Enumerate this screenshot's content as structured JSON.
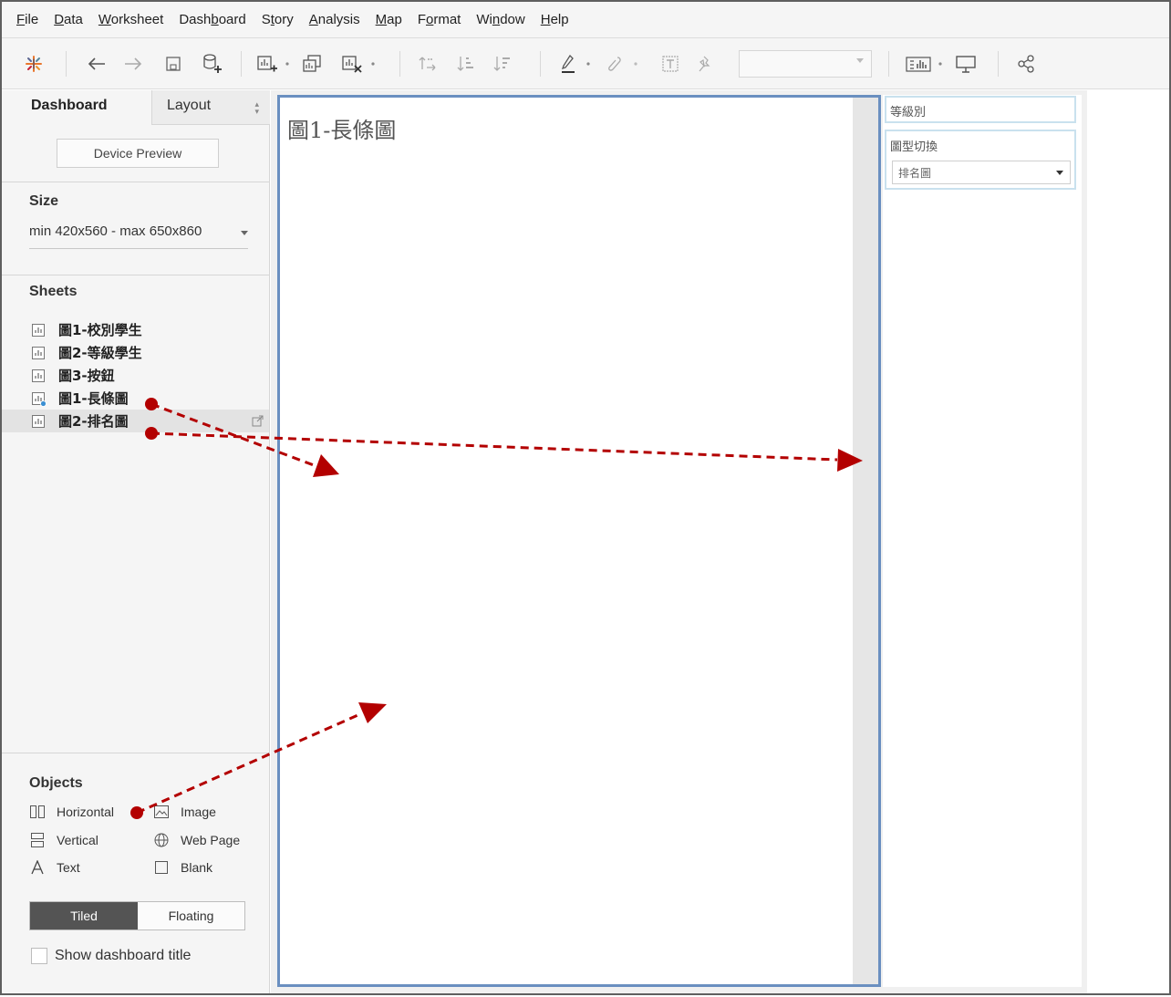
{
  "menu": [
    "File",
    "Data",
    "Worksheet",
    "Dashboard",
    "Story",
    "Analysis",
    "Map",
    "Format",
    "Window",
    "Help"
  ],
  "menu_mnemonics": [
    "F",
    "D",
    "W",
    "b",
    "t",
    "A",
    "M",
    "o",
    "n",
    "H"
  ],
  "icons": {
    "logo": "tableau-logo-icon",
    "back": "undo-arrow-icon",
    "forward": "redo-arrow-icon",
    "save": "save-icon",
    "new_datasource": "new-datasource-icon",
    "new_sheet": "new-worksheet-icon",
    "duplicate": "duplicate-sheet-icon",
    "clear": "clear-sheet-icon",
    "swap": "swap-rows-columns-icon",
    "sort_asc": "sort-ascending-icon",
    "sort_desc": "sort-descending-icon",
    "highlight": "highlight-icon",
    "group": "group-members-icon",
    "labels": "show-labels-icon",
    "pin": "fix-axes-icon",
    "show_me": "show-me-icon",
    "presentation": "presentation-mode-icon",
    "share": "share-icon"
  },
  "left_pane": {
    "tab_dashboard": "Dashboard",
    "tab_layout": "Layout",
    "device_preview": "Device Preview",
    "size_title": "Size",
    "size_value": "min 420x560 - max 650x860",
    "sheets_title": "Sheets",
    "sheets": [
      {
        "label": "圖1-校別學生",
        "selected": false,
        "in_use": false
      },
      {
        "label": "圖2-等級學生",
        "selected": false,
        "in_use": false
      },
      {
        "label": "圖3-按鈕",
        "selected": false,
        "in_use": false
      },
      {
        "label": "圖1-長條圖",
        "selected": false,
        "in_use": true
      },
      {
        "label": "圖2-排名圖",
        "selected": true,
        "in_use": false
      }
    ],
    "objects_title": "Objects",
    "objects": {
      "horizontal": "Horizontal",
      "image": "Image",
      "vertical": "Vertical",
      "web_page": "Web Page",
      "text": "Text",
      "blank": "Blank"
    },
    "tiled": "Tiled",
    "floating": "Floating",
    "show_title": "Show dashboard title"
  },
  "dashboard": {
    "sheet_title": "圖1-長條圖",
    "filter_title": "等級別",
    "parameter_title": "圖型切換",
    "parameter_value": "排名圖"
  },
  "colors": {
    "annotation_arrow": "#b30000",
    "container_border": "#6a8fc0",
    "filter_border": "#c9e1ee",
    "tiled_active": "#545454"
  }
}
